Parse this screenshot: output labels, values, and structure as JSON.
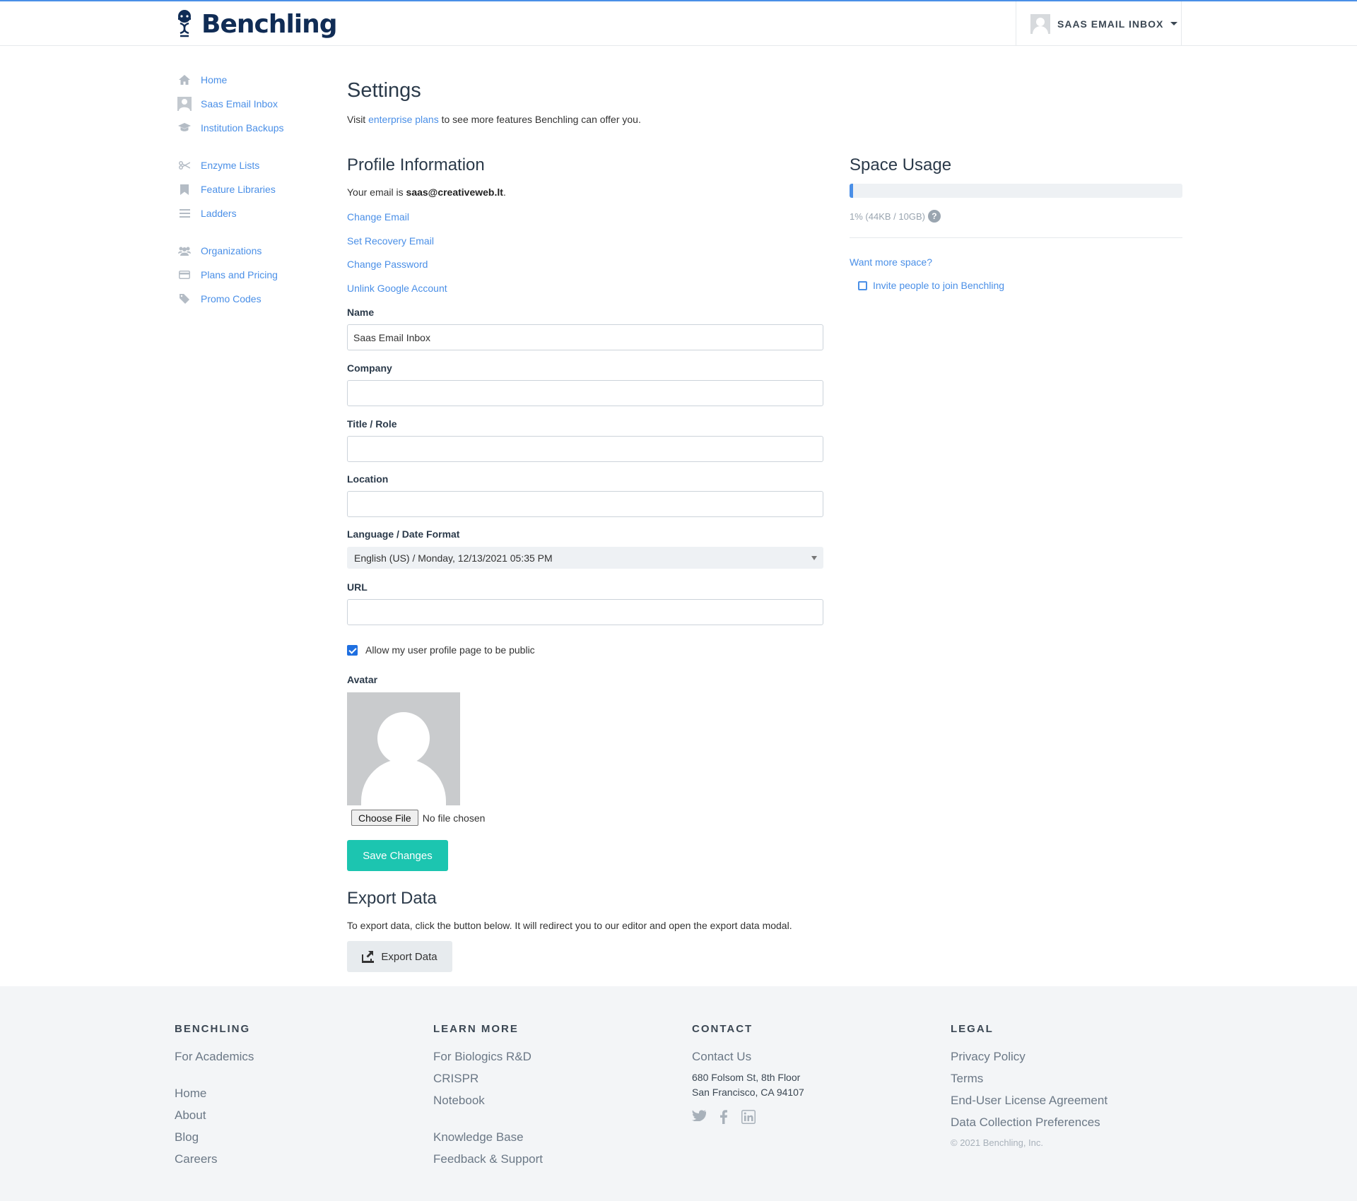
{
  "brand": {
    "name": "Benchling"
  },
  "header": {
    "user_label": "SAAS EMAIL INBOX"
  },
  "sidebar": {
    "groups": [
      [
        {
          "label": "Home",
          "icon": "home-icon"
        },
        {
          "label": "Saas Email Inbox",
          "icon": "user-icon"
        },
        {
          "label": "Institution Backups",
          "icon": "graduation-cap-icon"
        }
      ],
      [
        {
          "label": "Enzyme Lists",
          "icon": "scissors-icon"
        },
        {
          "label": "Feature Libraries",
          "icon": "bookmark-icon"
        },
        {
          "label": "Ladders",
          "icon": "list-icon"
        }
      ],
      [
        {
          "label": "Organizations",
          "icon": "users-icon"
        },
        {
          "label": "Plans and Pricing",
          "icon": "credit-card-icon"
        },
        {
          "label": "Promo Codes",
          "icon": "tag-icon"
        }
      ]
    ]
  },
  "settings": {
    "title": "Settings",
    "intro_before": "Visit ",
    "intro_link": "enterprise plans",
    "intro_after": " to see more features Benchling can offer you."
  },
  "profile": {
    "title": "Profile Information",
    "email_prefix": "Your email is ",
    "email": "saas@creativeweb.lt",
    "email_suffix": ".",
    "links": [
      "Change Email",
      "Set Recovery Email",
      "Change Password",
      "Unlink Google Account"
    ],
    "fields": {
      "name": {
        "label": "Name",
        "value": "Saas Email Inbox"
      },
      "company": {
        "label": "Company",
        "value": ""
      },
      "title": {
        "label": "Title / Role",
        "value": ""
      },
      "location": {
        "label": "Location",
        "value": ""
      },
      "language": {
        "label": "Language / Date Format",
        "value": "English (US) / Monday, 12/13/2021 05:35 PM"
      },
      "url": {
        "label": "URL",
        "value": ""
      }
    },
    "public_checkbox": {
      "label": "Allow my user profile page to be public",
      "checked": true
    },
    "avatar_label": "Avatar",
    "file_button": "Choose File",
    "file_status": "No file chosen",
    "save_button": "Save Changes"
  },
  "export": {
    "title": "Export Data",
    "description": "To export data, click the button below. It will redirect you to our editor and open the export data modal.",
    "button": "Export Data"
  },
  "space": {
    "title": "Space Usage",
    "usage_fraction": 0.01,
    "usage_text": "1% (44KB / 10GB)",
    "help": "?",
    "want_more": "Want more space?",
    "invite": "Invite people to join Benchling"
  },
  "footer": {
    "benchling": {
      "heading": "BENCHLING",
      "top": [
        "For Academics"
      ],
      "links": [
        "Home",
        "About",
        "Blog",
        "Careers"
      ]
    },
    "learn": {
      "heading": "LEARN MORE",
      "top": [
        "For Biologics R&D",
        "CRISPR",
        "Notebook"
      ],
      "links": [
        "Knowledge Base",
        "Feedback & Support"
      ]
    },
    "contact": {
      "heading": "CONTACT",
      "link": "Contact Us",
      "address_line1": "680 Folsom St, 8th Floor",
      "address_line2": "San Francisco, CA 94107",
      "social": [
        "twitter-icon",
        "facebook-icon",
        "linkedin-icon"
      ]
    },
    "legal": {
      "heading": "LEGAL",
      "links": [
        "Privacy Policy",
        "Terms",
        "End-User License Agreement",
        "Data Collection Preferences"
      ],
      "copyright": "© 2021 Benchling, Inc."
    }
  },
  "colors": {
    "accent": "#4a8fe7",
    "save": "#1cc5b0",
    "brand": "#102c55"
  }
}
